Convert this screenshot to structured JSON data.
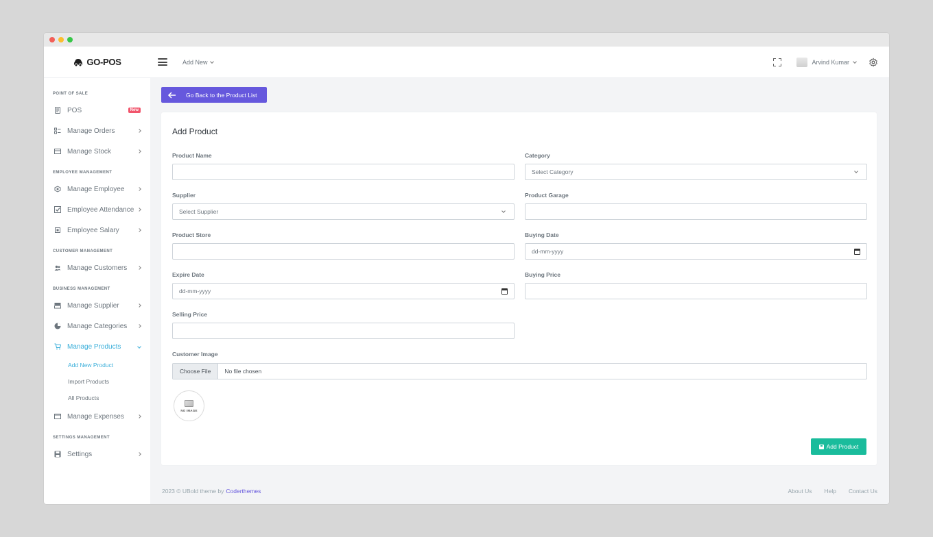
{
  "app": {
    "name": "GO-POS"
  },
  "topbar": {
    "add_new": "Add New",
    "user_name": "Arvind Kumar"
  },
  "sidebar": {
    "sections": [
      {
        "title": "POINT OF SALE"
      },
      {
        "title": "EMPLOYEE MANAGEMENT"
      },
      {
        "title": "CUSTOMER MANAGEMENT"
      },
      {
        "title": "BUSINESS MANAGEMENT"
      },
      {
        "title": "SETTINGS MANAGEMENT"
      }
    ],
    "items": [
      {
        "label": "POS",
        "badge": "New",
        "icon": "pos-icon"
      },
      {
        "label": "Manage Orders",
        "icon": "orders-icon"
      },
      {
        "label": "Manage Stock",
        "icon": "stock-icon"
      },
      {
        "label": "Manage Employee",
        "icon": "employee-icon"
      },
      {
        "label": "Employee Attendance",
        "icon": "attendance-icon"
      },
      {
        "label": "Employee Salary",
        "icon": "salary-icon"
      },
      {
        "label": "Manage Customers",
        "icon": "customers-icon"
      },
      {
        "label": "Manage Supplier",
        "icon": "supplier-icon"
      },
      {
        "label": "Manage Categories",
        "icon": "categories-icon"
      },
      {
        "label": "Manage Products",
        "icon": "products-icon"
      },
      {
        "label": "Manage Expenses",
        "icon": "expenses-icon"
      },
      {
        "label": "Settings",
        "icon": "settings-icon"
      }
    ],
    "product_sub_items": [
      "Add New Product",
      "Import Products",
      "All Products"
    ]
  },
  "page": {
    "back_button": "Go Back to the Product List",
    "card_title": "Add Product",
    "fields": {
      "product_name": {
        "label": "Product Name",
        "value": ""
      },
      "category": {
        "label": "Category",
        "value": "Select Category"
      },
      "supplier": {
        "label": "Supplier",
        "value": "Select Supplier"
      },
      "product_garage": {
        "label": "Product Garage",
        "value": ""
      },
      "product_store": {
        "label": "Product Store",
        "value": ""
      },
      "buying_date": {
        "label": "Buying Date",
        "value": "dd-mm-yyyy"
      },
      "expire_date": {
        "label": "Expire Date",
        "value": "dd-mm-yyyy"
      },
      "buying_price": {
        "label": "Buying Price",
        "value": ""
      },
      "selling_price": {
        "label": "Selling Price",
        "value": ""
      }
    },
    "image_field": {
      "label": "Customer Image",
      "button": "Choose File",
      "file_name": "No file chosen",
      "placeholder_text": "NO IMAGE"
    },
    "submit_button": "Add Product"
  },
  "footer": {
    "copyright": "2023 © UBold theme by ",
    "brand": "Coderthemes",
    "links": [
      "About Us",
      "Help",
      "Contact Us"
    ]
  },
  "colors": {
    "primary": "#6658dd",
    "success": "#1abc9c",
    "info": "#3bafda",
    "danger": "#f1556c"
  }
}
